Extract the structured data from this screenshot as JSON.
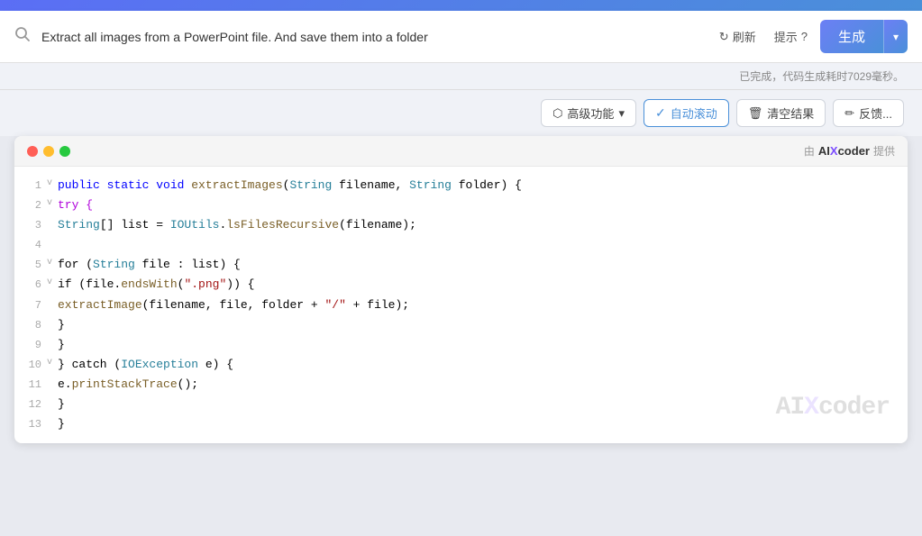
{
  "topBar": {},
  "searchBar": {
    "placeholder": "Extract all images from a PowerPoint file. And save them into a folder",
    "inputValue": "Extract all images from a PowerPoint file. And save them into a folder",
    "refreshLabel": "刷新",
    "hintLabel": "提示",
    "generateLabel": "生成"
  },
  "statusBar": {
    "message": "已完成，代码生成耗时7029毫秒。"
  },
  "toolbar": {
    "advancedLabel": "高级功能",
    "autoScrollLabel": "自动滚动",
    "clearLabel": "清空结果",
    "feedbackLabel": "反馈..."
  },
  "codeWindow": {
    "creditPrefix": "由",
    "creditBrand": "AIXcoder",
    "creditSuffix": "提供",
    "lines": [
      {
        "num": 1,
        "fold": "v",
        "tokens": [
          {
            "t": "public static void ",
            "c": "kw-blue"
          },
          {
            "t": "extractImages",
            "c": "kw-method"
          },
          {
            "t": "(",
            "c": "kw-plain"
          },
          {
            "t": "String",
            "c": "kw-teal"
          },
          {
            "t": " filename, ",
            "c": "kw-plain"
          },
          {
            "t": "String",
            "c": "kw-teal"
          },
          {
            "t": " folder) {",
            "c": "kw-plain"
          }
        ]
      },
      {
        "num": 2,
        "fold": "v",
        "tokens": [
          {
            "t": "    try {",
            "c": "kw-keyword"
          }
        ]
      },
      {
        "num": 3,
        "fold": "",
        "tokens": [
          {
            "t": "        ",
            "c": "kw-plain"
          },
          {
            "t": "String",
            "c": "kw-teal"
          },
          {
            "t": "[] list = ",
            "c": "kw-plain"
          },
          {
            "t": "IOUtils",
            "c": "kw-teal"
          },
          {
            "t": ".",
            "c": "kw-plain"
          },
          {
            "t": "lsFilesRecursive",
            "c": "kw-method"
          },
          {
            "t": "(filename);",
            "c": "kw-plain"
          }
        ]
      },
      {
        "num": 4,
        "fold": "",
        "tokens": []
      },
      {
        "num": 5,
        "fold": "v",
        "tokens": [
          {
            "t": "        for (",
            "c": "kw-plain"
          },
          {
            "t": "String",
            "c": "kw-teal"
          },
          {
            "t": " file : list) {",
            "c": "kw-plain"
          }
        ]
      },
      {
        "num": 6,
        "fold": "v",
        "tokens": [
          {
            "t": "            if (file.",
            "c": "kw-plain"
          },
          {
            "t": "endsWith",
            "c": "kw-method"
          },
          {
            "t": "(",
            "c": "kw-plain"
          },
          {
            "t": "\".png\"",
            "c": "kw-string"
          },
          {
            "t": ")) {",
            "c": "kw-plain"
          }
        ]
      },
      {
        "num": 7,
        "fold": "",
        "tokens": [
          {
            "t": "                ",
            "c": "kw-plain"
          },
          {
            "t": "extractImage",
            "c": "kw-method"
          },
          {
            "t": "(filename, file, folder + ",
            "c": "kw-plain"
          },
          {
            "t": "\"/\"",
            "c": "kw-string"
          },
          {
            "t": " + file);",
            "c": "kw-plain"
          }
        ]
      },
      {
        "num": 8,
        "fold": "",
        "tokens": [
          {
            "t": "            }",
            "c": "kw-plain"
          }
        ]
      },
      {
        "num": 9,
        "fold": "",
        "tokens": [
          {
            "t": "        }",
            "c": "kw-plain"
          }
        ]
      },
      {
        "num": 10,
        "fold": "v",
        "tokens": [
          {
            "t": "    } catch (",
            "c": "kw-plain"
          },
          {
            "t": "IOException",
            "c": "kw-teal"
          },
          {
            "t": " e) {",
            "c": "kw-plain"
          }
        ]
      },
      {
        "num": 11,
        "fold": "",
        "tokens": [
          {
            "t": "        e.",
            "c": "kw-plain"
          },
          {
            "t": "printStackTrace",
            "c": "kw-method"
          },
          {
            "t": "();",
            "c": "kw-plain"
          }
        ]
      },
      {
        "num": 12,
        "fold": "",
        "tokens": [
          {
            "t": "    }",
            "c": "kw-plain"
          }
        ]
      },
      {
        "num": 13,
        "fold": "",
        "tokens": [
          {
            "t": "}",
            "c": "kw-plain"
          }
        ]
      }
    ]
  },
  "watermark": {
    "text": "AIXcoder"
  }
}
